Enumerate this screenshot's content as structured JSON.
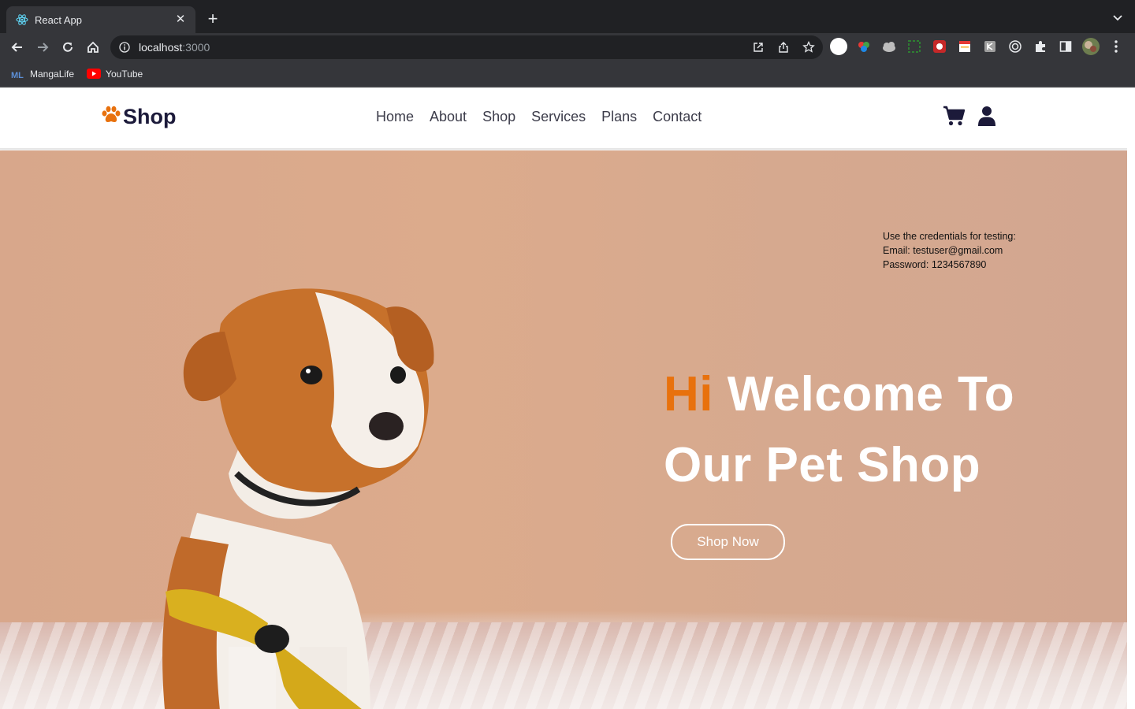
{
  "browser": {
    "tab": {
      "title": "React App",
      "close": "✕"
    },
    "new_tab": "+",
    "url": {
      "host": "localhost",
      "port": ":3000"
    },
    "bookmarks": [
      {
        "label": "MangaLife"
      },
      {
        "label": "YouTube"
      }
    ]
  },
  "site": {
    "brand": "Shop",
    "nav": [
      "Home",
      "About",
      "Shop",
      "Services",
      "Plans",
      "Contact"
    ],
    "credentials": {
      "line1": "Use the credentials for testing:",
      "line2": "Email: testuser@gmail.com",
      "line3": "Password: 1234567890"
    },
    "hero": {
      "hi": "Hi",
      "line1_rest": "Welcome To",
      "line2": "Our Pet Shop",
      "cta": "Shop Now"
    }
  },
  "colors": {
    "accent": "#e8710d",
    "brand_dark": "#1c1a3a",
    "hero_bg": "#d8a78b"
  },
  "icons": [
    "react-icon",
    "close-icon",
    "plus-icon",
    "back-icon",
    "forward-icon",
    "reload-icon",
    "home-icon",
    "info-icon",
    "open-external-icon",
    "share-icon",
    "star-icon",
    "paw-icon",
    "cart-icon",
    "user-icon"
  ]
}
